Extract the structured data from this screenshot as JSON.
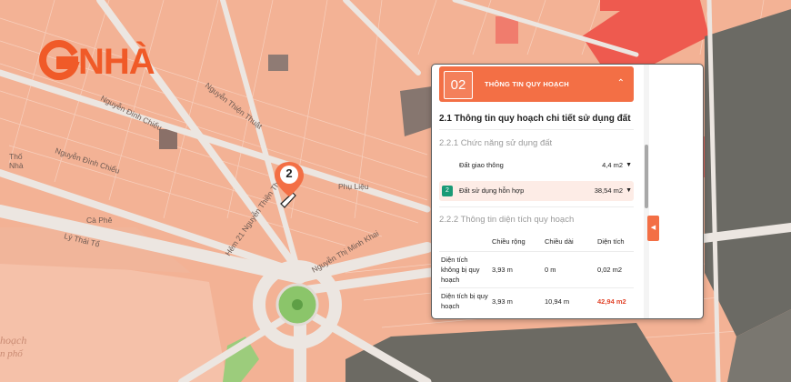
{
  "logo": {
    "text": "NHÀ"
  },
  "marker": {
    "number": "2"
  },
  "map_labels": {
    "nguyen_dinh_chieu_1": "Nguyễn Đình Chiểu",
    "nguyen_dinh_chieu_2": "Nguyễn Đình Chiểu",
    "nguyen_thien_thuat": "Nguyễn Thiện Thuật",
    "hem_21": "Hẻm 21 Nguyễn Thiện Thuật",
    "nguyen_thi_minh_khai": "Nguyễn Thị Minh Khai",
    "ly_thai_to": "Lý Thái Tổ",
    "ca_phe": "Cà Phê",
    "phu_lieu": "Phụ Liệu",
    "hoach": "hoạch",
    "phu": "n phố",
    "nha_tho": "Nhà",
    "tho": "Thố"
  },
  "panel": {
    "section_number": "02",
    "section_title": "THÔNG TIN QUY HOẠCH",
    "chevron": "⌃",
    "heading": "2.1 Thông tin quy hoạch chi tiết sử dụng đất",
    "subheading_use": "2.2.1 Chức năng sử dụng đất",
    "uses": [
      {
        "label": "Đất giao thông",
        "value": "4,4 m2",
        "badge": ""
      },
      {
        "label": "Đất sử dụng hỗn hợp",
        "value": "38,54 m2",
        "badge": "2"
      }
    ],
    "subheading_area": "2.2.2 Thông tin diện tích quy hoạch",
    "table": {
      "headers": [
        "",
        "Chiều rộng",
        "Chiều dài",
        "Diện tích"
      ],
      "rows": [
        [
          "Diện tích không bị quy hoạch",
          "3,93 m",
          "0 m",
          "0,02 m2"
        ],
        [
          "Diện tích bị quy hoạch",
          "3,93 m",
          "10,94 m",
          "42,94 m2"
        ]
      ]
    }
  },
  "colors": {
    "accent": "#f36f45",
    "map_base": "#f3b295",
    "road": "#e9e2dc",
    "highlight_red": "#e1442a",
    "badge_green": "#1a9a76"
  }
}
